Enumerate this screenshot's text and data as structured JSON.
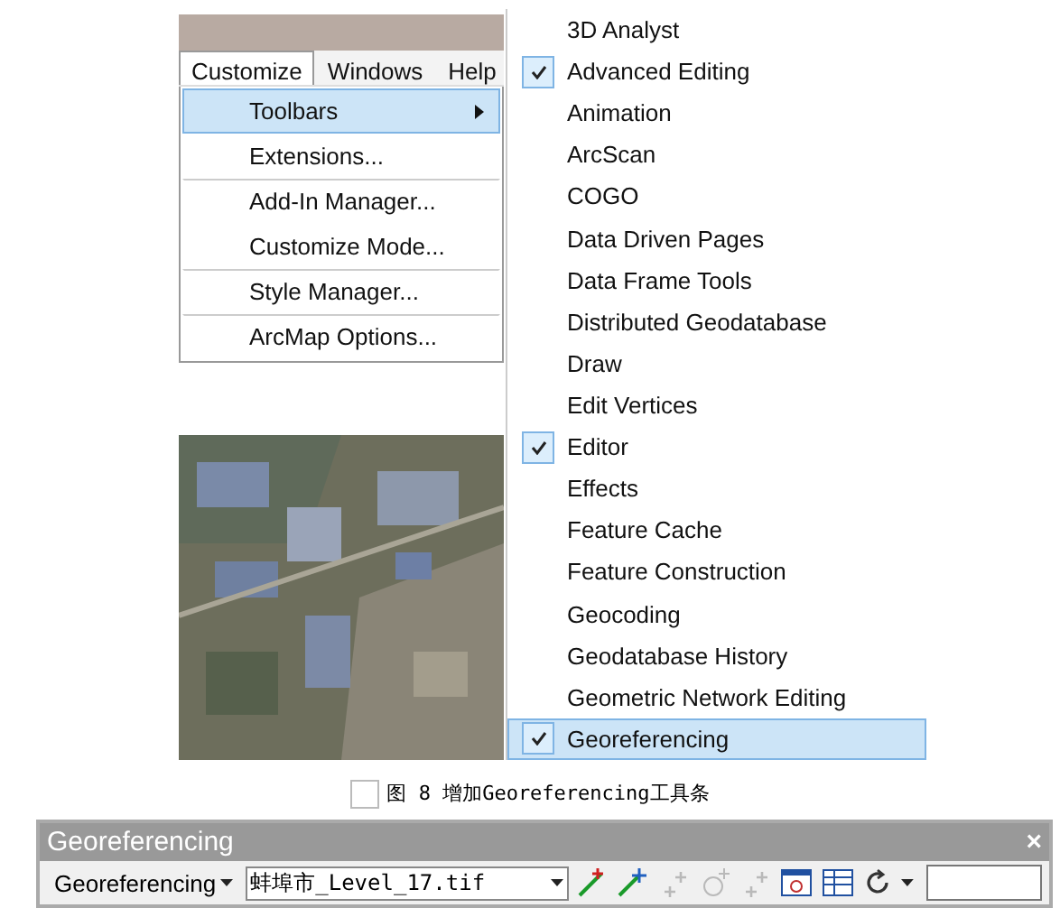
{
  "menu_bar": [
    {
      "label": "Customize",
      "selected": true
    },
    {
      "label": "Windows",
      "selected": false
    },
    {
      "label": "Help",
      "selected": false
    }
  ],
  "customize_menu": [
    {
      "label": "Toolbars",
      "selected": true,
      "has_submenu": true,
      "separator_before": false
    },
    {
      "label": "Extensions...",
      "selected": false,
      "has_submenu": false,
      "separator_before": false
    },
    {
      "label": "Add-In Manager...",
      "selected": false,
      "has_submenu": false,
      "separator_before": true
    },
    {
      "label": "Customize Mode...",
      "selected": false,
      "has_submenu": false,
      "separator_before": false
    },
    {
      "label": "Style Manager...",
      "selected": false,
      "has_submenu": false,
      "separator_before": true
    },
    {
      "label": "ArcMap Options...",
      "selected": false,
      "has_submenu": false,
      "separator_before": true
    }
  ],
  "toolbars_submenu": [
    {
      "label": "3D Analyst",
      "checked": false,
      "selected": false
    },
    {
      "label": "Advanced Editing",
      "checked": true,
      "selected": false
    },
    {
      "label": "Animation",
      "checked": false,
      "selected": false
    },
    {
      "label": "ArcScan",
      "checked": false,
      "selected": false
    },
    {
      "label": "COGO",
      "checked": false,
      "selected": false
    },
    {
      "label": "Data Driven Pages",
      "checked": false,
      "selected": false
    },
    {
      "label": "Data Frame Tools",
      "checked": false,
      "selected": false
    },
    {
      "label": "Distributed Geodatabase",
      "checked": false,
      "selected": false
    },
    {
      "label": "Draw",
      "checked": false,
      "selected": false
    },
    {
      "label": "Edit Vertices",
      "checked": false,
      "selected": false
    },
    {
      "label": "Editor",
      "checked": true,
      "selected": false
    },
    {
      "label": "Effects",
      "checked": false,
      "selected": false
    },
    {
      "label": "Feature Cache",
      "checked": false,
      "selected": false
    },
    {
      "label": "Feature Construction",
      "checked": false,
      "selected": false
    },
    {
      "label": "Geocoding",
      "checked": false,
      "selected": false
    },
    {
      "label": "Geodatabase History",
      "checked": false,
      "selected": false
    },
    {
      "label": "Geometric Network Editing",
      "checked": false,
      "selected": false
    },
    {
      "label": "Georeferencing",
      "checked": true,
      "selected": true
    }
  ],
  "caption": "图 8 增加Georeferencing工具条",
  "toolbar": {
    "title": "Georeferencing",
    "close": "×",
    "menu": "Georeferencing",
    "layer": "蚌埠市_Level_17.tif",
    "tools": [
      {
        "kind": "add",
        "disabled": false
      },
      {
        "kind": "auto",
        "disabled": false
      },
      {
        "kind": "points",
        "disabled": true
      },
      {
        "kind": "target",
        "disabled": true
      },
      {
        "kind": "points",
        "disabled": true
      },
      {
        "kind": "viewer",
        "disabled": false
      },
      {
        "kind": "table",
        "disabled": false
      },
      {
        "kind": "rotate",
        "disabled": false
      }
    ]
  }
}
